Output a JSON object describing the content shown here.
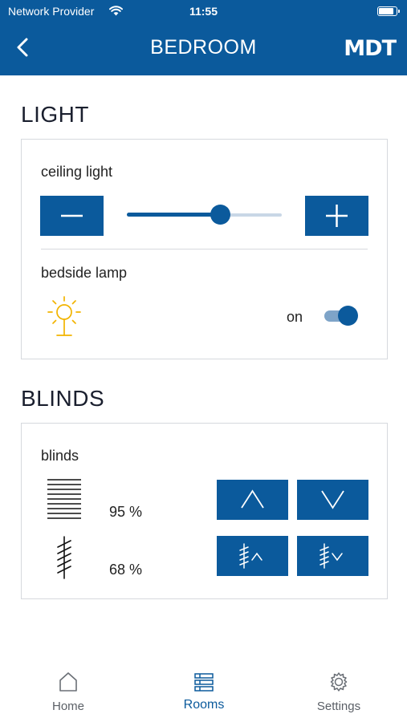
{
  "status_bar": {
    "carrier": "Network Provider",
    "time": "11:55",
    "battery_level": 0.9
  },
  "header": {
    "title": "BEDROOM",
    "logo_text": "MDT",
    "back_icon": "chevron-left-icon"
  },
  "light": {
    "section_title": "LIGHT",
    "ceiling_light": {
      "label": "ceiling light",
      "dim_level": 0.6
    },
    "bedside_lamp": {
      "label": "bedside lamp",
      "state_label": "on",
      "is_on": true,
      "icon": "lamp-sun-icon",
      "icon_color": "#f2b400"
    }
  },
  "blinds": {
    "section_title": "BLINDS",
    "item": {
      "label": "blinds",
      "position": "95 %",
      "slat_angle": "68 %"
    }
  },
  "tabs": [
    {
      "label": "Home",
      "icon": "home-icon",
      "active": false
    },
    {
      "label": "Rooms",
      "icon": "rooms-list-icon",
      "active": true
    },
    {
      "label": "Settings",
      "icon": "gear-icon",
      "active": false
    }
  ],
  "colors": {
    "brand": "#0b5a9c",
    "lamp": "#f2b400",
    "border": "#d6d9de"
  }
}
